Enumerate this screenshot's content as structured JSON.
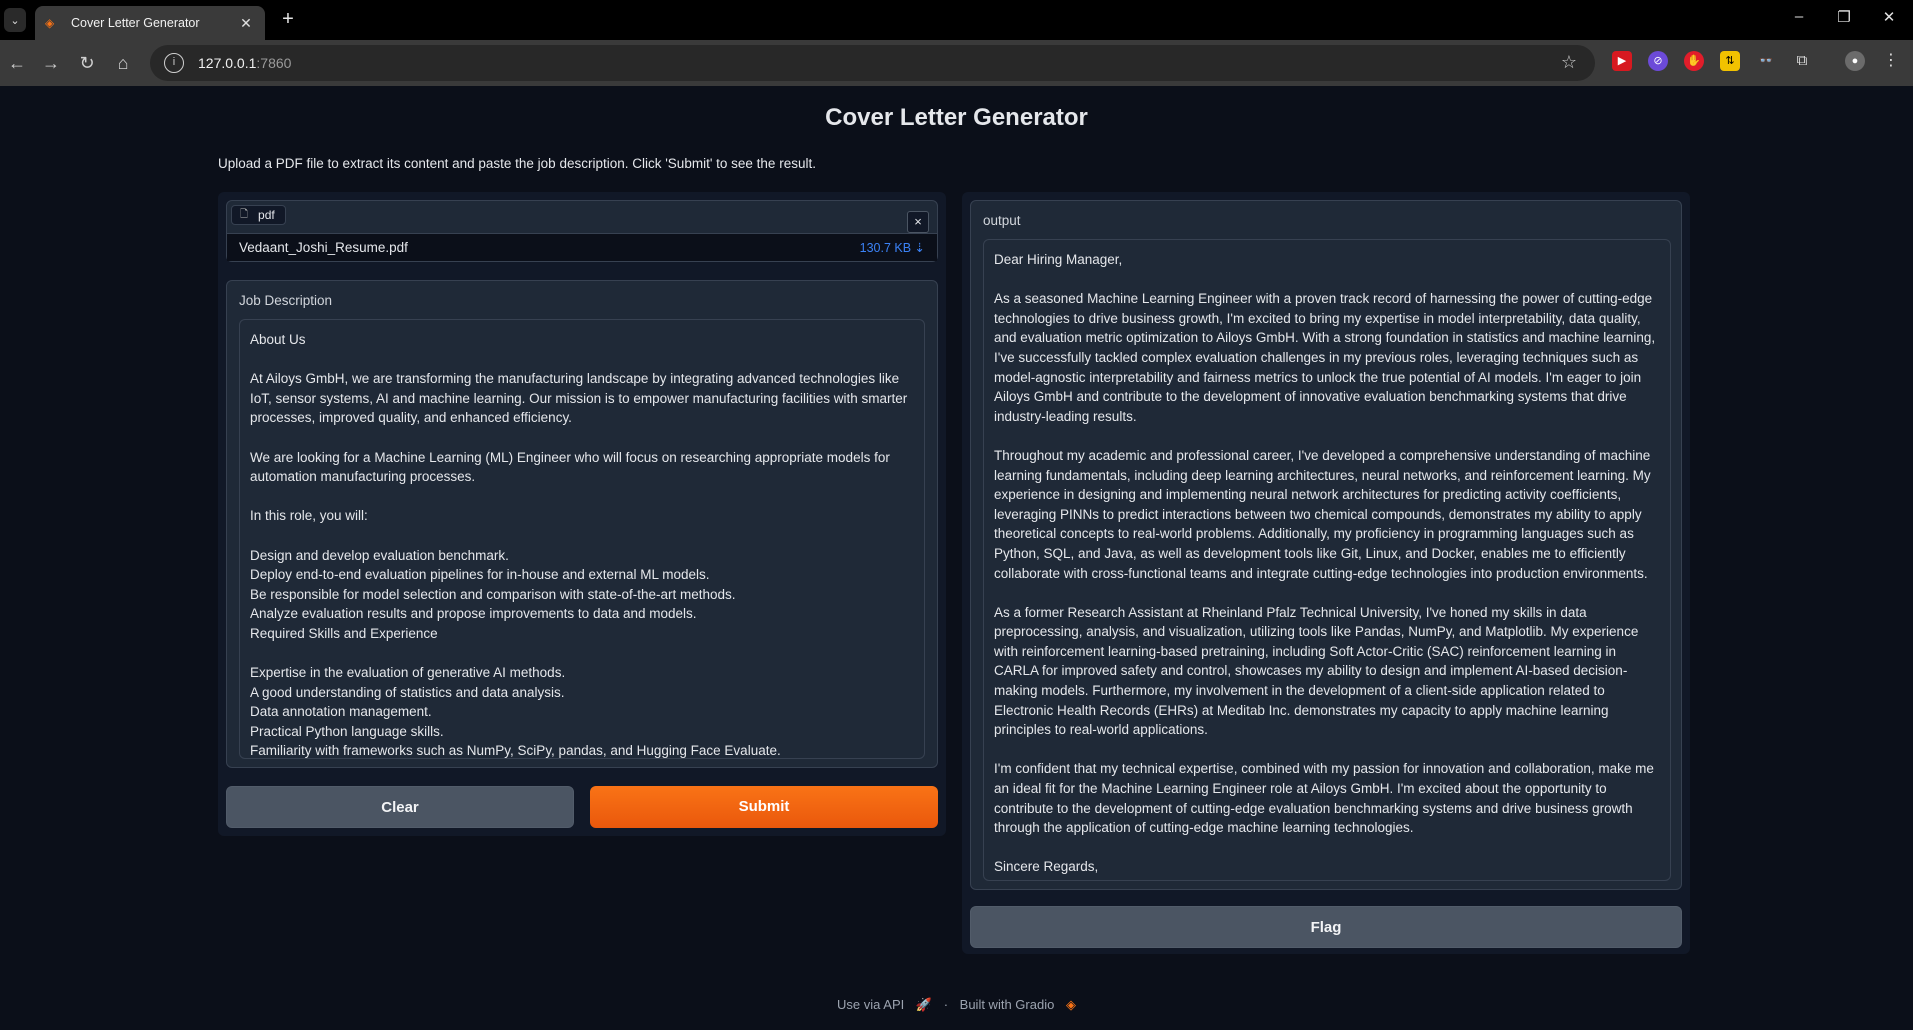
{
  "browser": {
    "tab_title": "Cover Letter Generator",
    "url_host": "127.0.0.1",
    "url_port": ":7860"
  },
  "page": {
    "title": "Cover Letter Generator",
    "description": "Upload a PDF file to extract its content and paste the job description. Click 'Submit' to see the result."
  },
  "file_input": {
    "label": "pdf",
    "file_name": "Vedaant_Joshi_Resume.pdf",
    "file_size": "130.7 KB ⇣",
    "clear_icon": "×"
  },
  "job_description": {
    "label": "Job Description",
    "value": "About Us\n\nAt Ailoys GmbH, we are transforming the manufacturing landscape by integrating advanced technologies like IoT, sensor systems, AI and machine learning. Our mission is to empower manufacturing facilities with smarter processes, improved quality, and enhanced efficiency.\n\nWe are looking for a Machine Learning (ML) Engineer who will focus on researching appropriate models for automation manufacturing processes.\n\nIn this role, you will:\n\nDesign and develop evaluation benchmark.\nDeploy end-to-end evaluation pipelines for in-house and external ML models.\nBe responsible for model selection and comparison with state-of-the-art methods.\nAnalyze evaluation results and propose improvements to data and models.\nRequired Skills and Experience\n\nExpertise in the evaluation of generative AI methods.\nA good understanding of statistics and data analysis.\nData annotation management.\nPractical Python language skills.\nFamiliarity with frameworks such as NumPy, SciPy, pandas, and Hugging Face Evaluate."
  },
  "buttons": {
    "clear": "Clear",
    "submit": "Submit",
    "flag": "Flag"
  },
  "output": {
    "label": "output",
    "value": "Dear Hiring Manager,\n\nAs a seasoned Machine Learning Engineer with a proven track record of harnessing the power of cutting-edge technologies to drive business growth, I'm excited to bring my expertise in model interpretability, data quality, and evaluation metric optimization to Ailoys GmbH. With a strong foundation in statistics and machine learning, I've successfully tackled complex evaluation challenges in my previous roles, leveraging techniques such as model-agnostic interpretability and fairness metrics to unlock the true potential of AI models. I'm eager to join Ailoys GmbH and contribute to the development of innovative evaluation benchmarking systems that drive industry-leading results.\n\nThroughout my academic and professional career, I've developed a comprehensive understanding of machine learning fundamentals, including deep learning architectures, neural networks, and reinforcement learning. My experience in designing and implementing neural network architectures for predicting activity coefficients, leveraging PINNs to predict interactions between two chemical compounds, demonstrates my ability to apply theoretical concepts to real-world problems. Additionally, my proficiency in programming languages such as Python, SQL, and Java, as well as development tools like Git, Linux, and Docker, enables me to efficiently collaborate with cross-functional teams and integrate cutting-edge technologies into production environments.\n\nAs a former Research Assistant at Rheinland Pfalz Technical University, I've honed my skills in data preprocessing, analysis, and visualization, utilizing tools like Pandas, NumPy, and Matplotlib. My experience with reinforcement learning-based pretraining, including Soft Actor-Critic (SAC) reinforcement learning in CARLA for improved safety and control, showcases my ability to design and implement AI-based decision-making models. Furthermore, my involvement in the development of a client-side application related to Electronic Health Records (EHRs) at Meditab Inc. demonstrates my capacity to apply machine learning principles to real-world applications.\n\nI'm confident that my technical expertise, combined with my passion for innovation and collaboration, make me an ideal fit for the Machine Learning Engineer role at Ailoys GmbH. I'm excited about the opportunity to contribute to the development of cutting-edge evaluation benchmarking systems and drive business growth through the application of cutting-edge machine learning technologies.\n\nSincere Regards,\nVedaant Joshi"
  },
  "footer": {
    "api": "Use via API",
    "separator": "·",
    "built": "Built with Gradio"
  },
  "icons": {
    "accent": "#f97316",
    "link_blue": "#3b82f6"
  }
}
